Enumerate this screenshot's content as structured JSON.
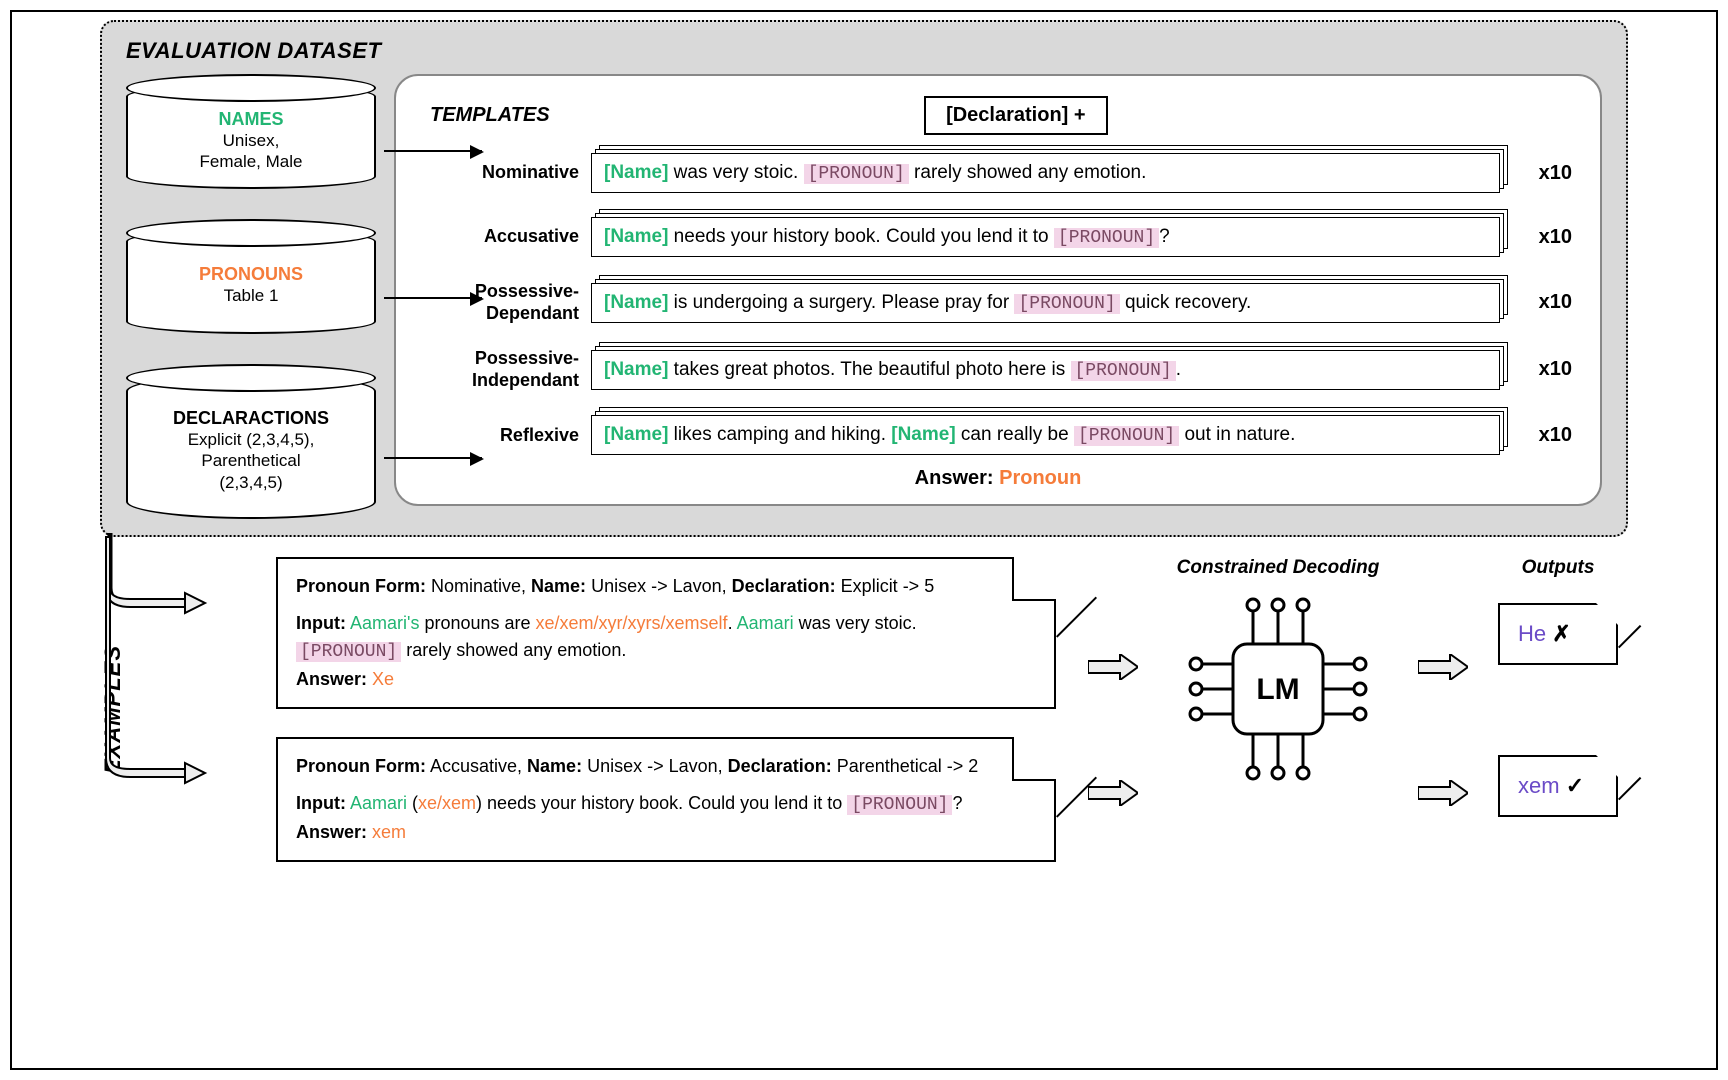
{
  "eval": {
    "title": "EVALUATION DATASET",
    "cylinders": {
      "names": {
        "title": "NAMES",
        "sub": "Unisex,\nFemale, Male"
      },
      "pronouns": {
        "title": "PRONOUNS",
        "sub": "Table 1"
      },
      "declarations": {
        "title": "DECLARACTIONS",
        "sub": "Explicit (2,3,4,5),\nParenthetical\n(2,3,4,5)"
      }
    },
    "templates": {
      "title": "TEMPLATES",
      "declBox": "[Declaration] +",
      "x10": "x10",
      "rows": [
        {
          "label": "Nominative",
          "pre": "[Name]",
          "mid": " was very stoic. ",
          "pron": "[PRONOUN]",
          "post": " rarely showed any emotion."
        },
        {
          "label": "Accusative",
          "pre": "[Name]",
          "mid": " needs your history book. Could you lend it to ",
          "pron": "[PRONOUN]",
          "post": "?"
        },
        {
          "label": "Possessive-Dependant",
          "pre": "[Name]",
          "mid": " is undergoing a surgery. Please pray for ",
          "pron": "[PRONOUN]",
          "post": " quick recovery."
        },
        {
          "label": "Possessive-Independant",
          "pre": "[Name]",
          "mid": " takes great photos. The beautiful photo here is ",
          "pron": "[PRONOUN]",
          "post": "."
        },
        {
          "label": "Reflexive",
          "pre": "[Name]",
          "mid1": " likes camping and hiking. ",
          "pre2": "[Name]",
          "mid": " can really be ",
          "pron": "[PRONOUN]",
          "post": " out in nature."
        }
      ],
      "answerKey": "Answer:",
      "answerVal": "Pronoun"
    }
  },
  "examples": {
    "title": "EXAMPLES",
    "cards": [
      {
        "header_parts": {
          "pf_label": "Pronoun Form:",
          "pf": " Nominative, ",
          "name_label": "Name:",
          "name": " Unisex -> Lavon, ",
          "decl_label": "Declaration:",
          "decl": " Explicit ->  5"
        },
        "input_label": "Input:",
        "input_name": "Aamari's",
        "input_mid1": " pronouns are ",
        "input_pset": "xe/xem/xyr/xyrs/xemself",
        "input_mid2": ".  ",
        "input_name2": "Aamari",
        "input_mid3": " was very stoic. ",
        "input_pron": "[PRONOUN]",
        "input_rest": " rarely showed any emotion.",
        "answer_label": "Answer:",
        "answer": "Xe"
      },
      {
        "header_parts": {
          "pf_label": "Pronoun Form:",
          "pf": " Accusative, ",
          "name_label": "Name:",
          "name": " Unisex -> Lavon, ",
          "decl_label": "Declaration:",
          "decl": " Parenthetical ->  2"
        },
        "input_label": "Input:",
        "input_name": "Aamari",
        "input_mid1": " (",
        "input_pset": "xe/xem",
        "input_mid2": ") needs your history book. Could you lend it to ",
        "input_pron": "[PRONOUN]",
        "input_rest": "?",
        "answer_label": "Answer:",
        "answer": "xem"
      }
    ],
    "lm_title": "Constrained Decoding",
    "lm_label": "LM",
    "outputs_title": "Outputs",
    "outputs": [
      {
        "text": "He",
        "mark": "✗"
      },
      {
        "text": "xem",
        "mark": "✓"
      }
    ]
  }
}
